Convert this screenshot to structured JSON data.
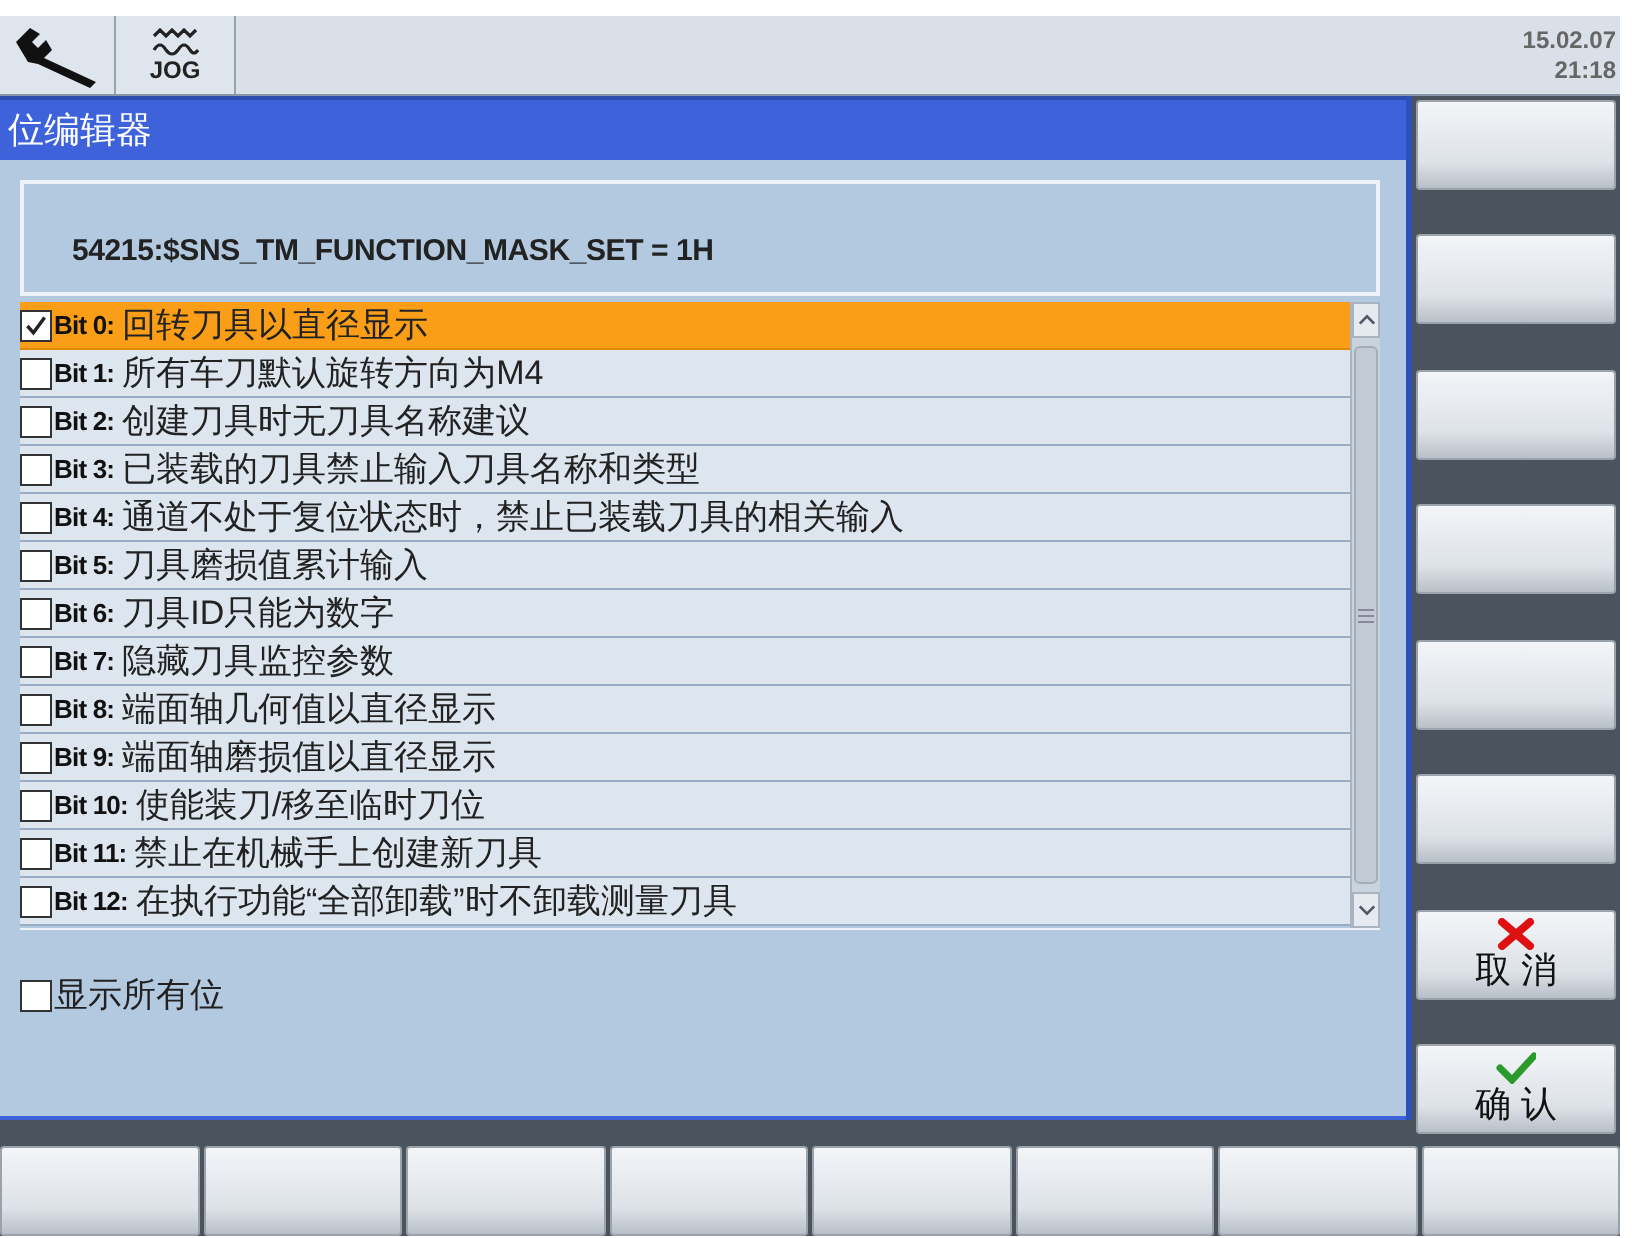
{
  "header": {
    "mode": "JOG",
    "date": "15.02.07",
    "time": "21:18"
  },
  "dialog": {
    "title": "位编辑器",
    "parameter": "54215:$SNS_TM_FUNCTION_MASK_SET = 1H",
    "bits": [
      {
        "bit": "Bit 0:",
        "description": "回转刀具以直径显示",
        "checked": true,
        "selected": true
      },
      {
        "bit": "Bit 1:",
        "description": "所有车刀默认旋转方向为M4",
        "checked": false,
        "selected": false
      },
      {
        "bit": "Bit 2:",
        "description": "创建刀具时无刀具名称建议",
        "checked": false,
        "selected": false
      },
      {
        "bit": "Bit 3:",
        "description": "已装载的刀具禁止输入刀具名称和类型",
        "checked": false,
        "selected": false
      },
      {
        "bit": "Bit 4:",
        "description": "通道不处于复位状态时，禁止已装载刀具的相关输入",
        "checked": false,
        "selected": false
      },
      {
        "bit": "Bit 5:",
        "description": "刀具磨损值累计输入",
        "checked": false,
        "selected": false
      },
      {
        "bit": "Bit 6:",
        "description": "刀具ID只能为数字",
        "checked": false,
        "selected": false
      },
      {
        "bit": "Bit 7:",
        "description": "隐藏刀具监控参数",
        "checked": false,
        "selected": false
      },
      {
        "bit": "Bit 8:",
        "description": "端面轴几何值以直径显示",
        "checked": false,
        "selected": false
      },
      {
        "bit": "Bit 9:",
        "description": "端面轴磨损值以直径显示",
        "checked": false,
        "selected": false
      },
      {
        "bit": "Bit 10:",
        "description": "使能装刀/移至临时刀位",
        "checked": false,
        "selected": false
      },
      {
        "bit": "Bit 11:",
        "description": "禁止在机械手上创建新刀具",
        "checked": false,
        "selected": false
      },
      {
        "bit": "Bit 12:",
        "description": "在执行功能“全部卸载”时不卸载测量刀具",
        "checked": false,
        "selected": false
      }
    ],
    "show_all": {
      "label": "显示所有位",
      "checked": false
    }
  },
  "vertical_softkeys": [
    {
      "kind": "blank"
    },
    {
      "kind": "blank"
    },
    {
      "kind": "blank"
    },
    {
      "kind": "blank"
    },
    {
      "kind": "blank"
    },
    {
      "kind": "blank"
    },
    {
      "kind": "cancel",
      "label": "取消"
    },
    {
      "kind": "confirm",
      "label": "确认"
    }
  ],
  "horizontal_softkeys": [
    {
      "kind": "blank"
    },
    {
      "kind": "blank"
    },
    {
      "kind": "blank"
    },
    {
      "kind": "blank"
    },
    {
      "kind": "blank"
    },
    {
      "kind": "blank"
    },
    {
      "kind": "blank"
    },
    {
      "kind": "blank"
    }
  ]
}
